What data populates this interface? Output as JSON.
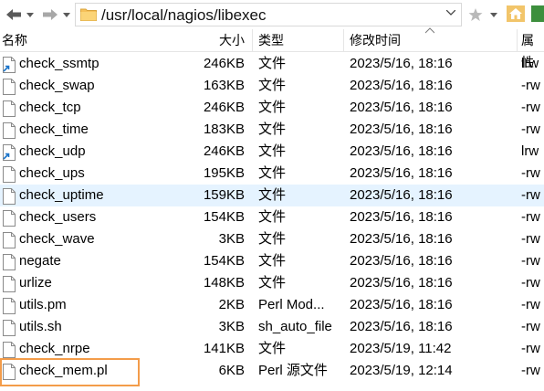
{
  "toolbar": {
    "address_path": "/usr/local/nagios/libexec"
  },
  "header": {
    "col_name": "名称",
    "col_size": "大小",
    "col_type": "类型",
    "col_modified": "修改时间",
    "col_attr": "属性"
  },
  "files": [
    {
      "name": "check_ssmtp",
      "size": "246KB",
      "type": "文件",
      "modified": "2023/5/16, 18:16",
      "attr": "lrw",
      "icon": "symlink-file-icon"
    },
    {
      "name": "check_swap",
      "size": "163KB",
      "type": "文件",
      "modified": "2023/5/16, 18:16",
      "attr": "-rw",
      "icon": "file-icon"
    },
    {
      "name": "check_tcp",
      "size": "246KB",
      "type": "文件",
      "modified": "2023/5/16, 18:16",
      "attr": "-rw",
      "icon": "file-icon"
    },
    {
      "name": "check_time",
      "size": "183KB",
      "type": "文件",
      "modified": "2023/5/16, 18:16",
      "attr": "-rw",
      "icon": "file-icon"
    },
    {
      "name": "check_udp",
      "size": "246KB",
      "type": "文件",
      "modified": "2023/5/16, 18:16",
      "attr": "lrw",
      "icon": "symlink-file-icon"
    },
    {
      "name": "check_ups",
      "size": "195KB",
      "type": "文件",
      "modified": "2023/5/16, 18:16",
      "attr": "-rw",
      "icon": "file-icon"
    },
    {
      "name": "check_uptime",
      "size": "159KB",
      "type": "文件",
      "modified": "2023/5/16, 18:16",
      "attr": "-rw",
      "icon": "file-icon",
      "hover": true
    },
    {
      "name": "check_users",
      "size": "154KB",
      "type": "文件",
      "modified": "2023/5/16, 18:16",
      "attr": "-rw",
      "icon": "file-icon"
    },
    {
      "name": "check_wave",
      "size": "3KB",
      "type": "文件",
      "modified": "2023/5/16, 18:16",
      "attr": "-rw",
      "icon": "file-icon"
    },
    {
      "name": "negate",
      "size": "154KB",
      "type": "文件",
      "modified": "2023/5/16, 18:16",
      "attr": "-rw",
      "icon": "file-icon"
    },
    {
      "name": "urlize",
      "size": "148KB",
      "type": "文件",
      "modified": "2023/5/16, 18:16",
      "attr": "-rw",
      "icon": "file-icon"
    },
    {
      "name": "utils.pm",
      "size": "2KB",
      "type": "Perl Mod...",
      "modified": "2023/5/16, 18:16",
      "attr": "-rw",
      "icon": "file-icon"
    },
    {
      "name": "utils.sh",
      "size": "3KB",
      "type": "sh_auto_file",
      "modified": "2023/5/16, 18:16",
      "attr": "-rw",
      "icon": "file-icon"
    },
    {
      "name": "check_nrpe",
      "size": "141KB",
      "type": "文件",
      "modified": "2023/5/19, 11:42",
      "attr": "-rw",
      "icon": "file-icon"
    },
    {
      "name": "check_mem.pl",
      "size": "6KB",
      "type": "Perl 源文件",
      "modified": "2023/5/19, 12:14",
      "attr": "-rw",
      "icon": "file-icon"
    }
  ],
  "colors": {
    "hover_row": "#e5f3ff",
    "highlight_border": "#f39c4a",
    "folder": "#f6c15a",
    "symlink_arrow": "#1a73c9"
  }
}
